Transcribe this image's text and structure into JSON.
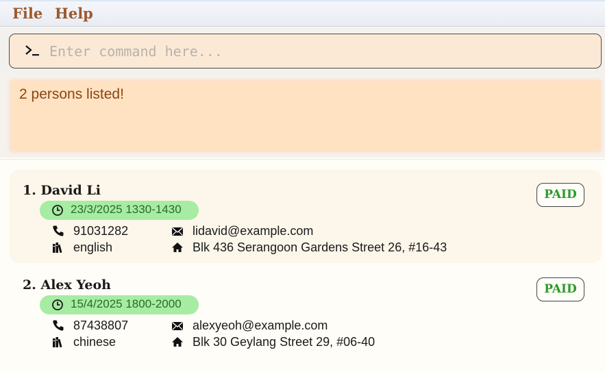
{
  "menu": {
    "file": "File",
    "help": "Help"
  },
  "command": {
    "placeholder": "Enter command here...",
    "value": ""
  },
  "result": {
    "message": "2 persons listed!"
  },
  "persons": [
    {
      "name": "1. David Li",
      "status": "PAID",
      "schedule": "23/3/2025 1330-1430",
      "phone": "91031282",
      "email": "lidavid@example.com",
      "subject": "english",
      "address": "Blk 436 Serangoon Gardens Street 26, #16-43"
    },
    {
      "name": "2. Alex Yeoh",
      "status": "PAID",
      "schedule": "15/4/2025 1800-2000",
      "phone": "87438807",
      "email": "alexyeoh@example.com",
      "subject": "chinese",
      "address": "Blk 30 Geylang Street 29, #06-40"
    }
  ],
  "colors": {
    "menu_text": "#9b5a2e",
    "paid_text": "#2a9a2a",
    "schedule_bg": "#a6eca3",
    "result_bg": "#ffe2c2",
    "result_text": "#8b4513"
  },
  "icons": {
    "prompt": "terminal-prompt-icon",
    "clock": "clock-icon",
    "phone": "phone-icon",
    "email": "envelope-icon",
    "subject": "books-icon",
    "address": "home-icon"
  }
}
